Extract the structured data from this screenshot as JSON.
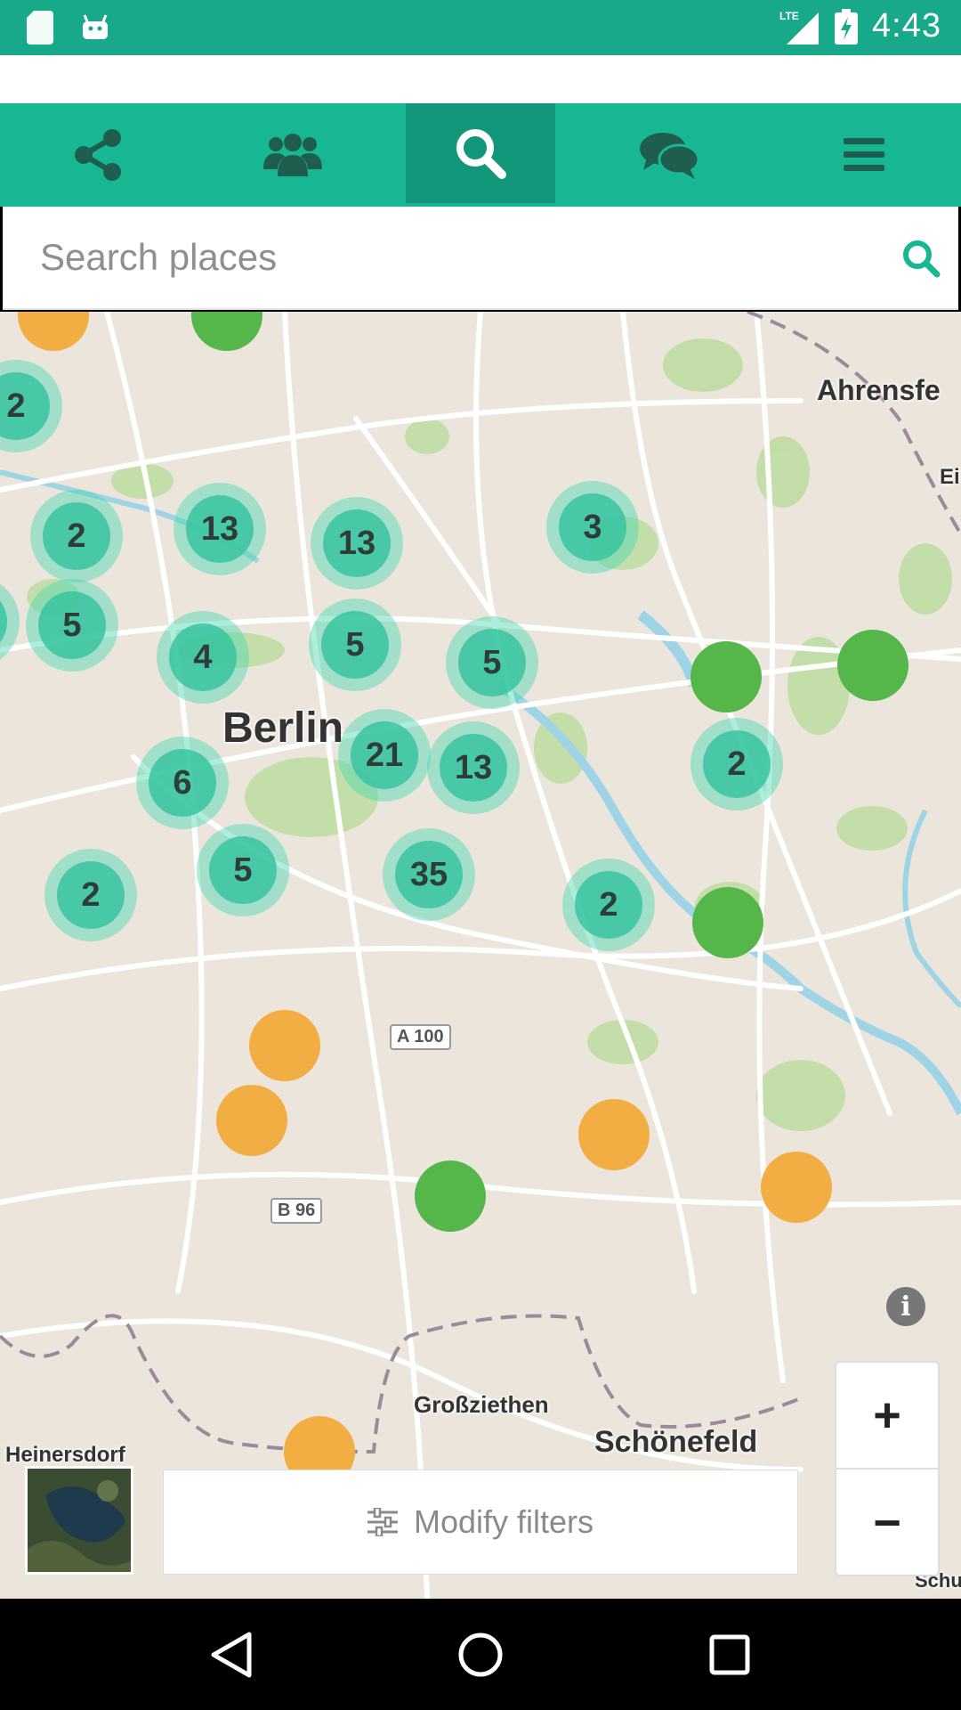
{
  "status_bar": {
    "time": "4:43",
    "network": "LTE",
    "icons": [
      "sd-card-icon",
      "android-icon",
      "lte-signal-icon",
      "battery-charging-icon"
    ]
  },
  "toolbar": {
    "items": [
      {
        "name": "share",
        "icon": "share-icon"
      },
      {
        "name": "groups",
        "icon": "people-icon"
      },
      {
        "name": "search",
        "icon": "search-icon",
        "active": true
      },
      {
        "name": "chat",
        "icon": "chat-icon"
      },
      {
        "name": "menu",
        "icon": "menu-icon"
      }
    ],
    "colors": {
      "bar": "#16b792",
      "active": "#13977a"
    }
  },
  "search": {
    "placeholder": "Search places",
    "value": ""
  },
  "map": {
    "labels": {
      "berlin": "Berlin",
      "ahrensfelde": "Ahrensfe",
      "ei": "Ei",
      "grossziethen": "Großziethen",
      "schonefeld": "Schönefeld",
      "heinersdorf": "Heinersdorf",
      "schu": "Schu"
    },
    "road_shields": {
      "a100": "A 100",
      "b96": "B 96"
    },
    "clusters": [
      {
        "count": "2"
      },
      {
        "count": "2"
      },
      {
        "count": "13"
      },
      {
        "count": "13"
      },
      {
        "count": "3"
      },
      {
        "count": "5"
      },
      {
        "count": "4"
      },
      {
        "count": "5"
      },
      {
        "count": "5"
      },
      {
        "count": "21"
      },
      {
        "count": "13"
      },
      {
        "count": "6"
      },
      {
        "count": "2"
      },
      {
        "count": "5"
      },
      {
        "count": "35"
      },
      {
        "count": "2"
      },
      {
        "count": "2"
      }
    ],
    "marker_colors": {
      "cluster": "#38c4a0",
      "green": "#55b64a",
      "orange": "#f2ad43"
    }
  },
  "controls": {
    "zoom_in": "+",
    "zoom_out": "−",
    "info": "i",
    "filters_label": "Modify filters"
  }
}
